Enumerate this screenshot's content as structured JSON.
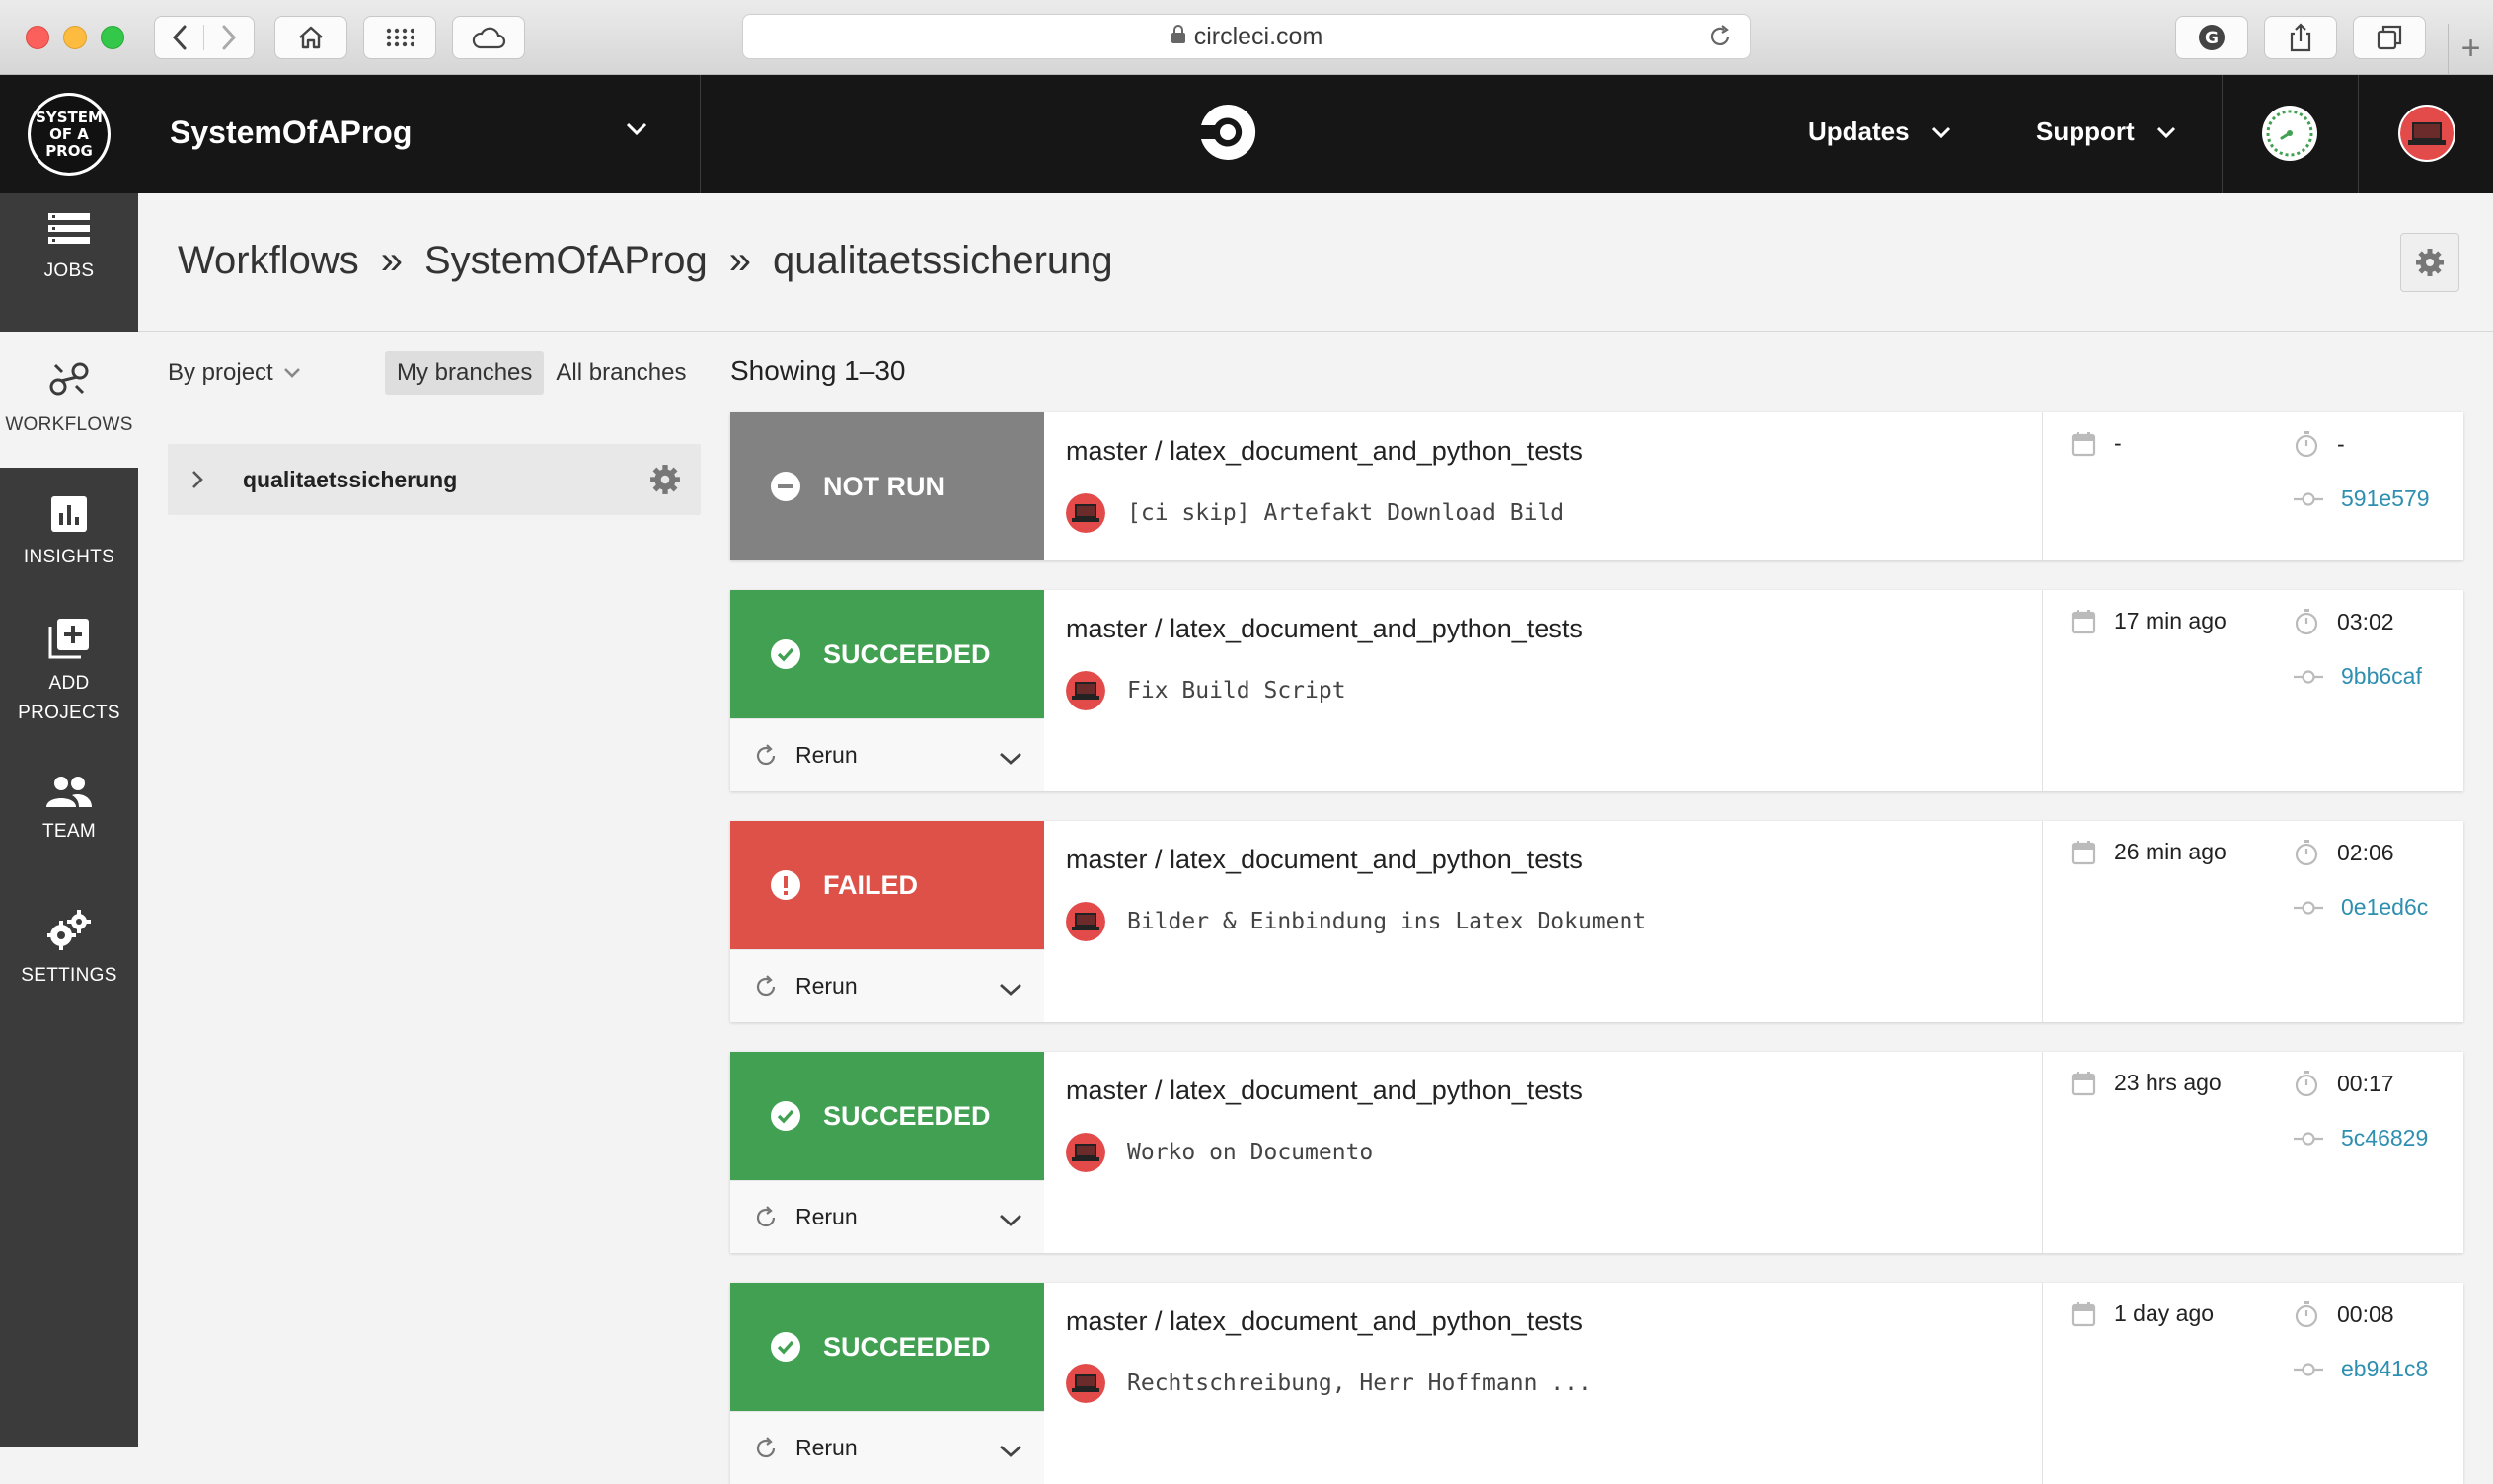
{
  "browser": {
    "url": "circleci.com",
    "new_tab_symbol": "+"
  },
  "header": {
    "org_logo_text": "SYSTEM OF A PROG",
    "org_name": "SystemOfAProg",
    "updates_label": "Updates",
    "support_label": "Support"
  },
  "sidebar": {
    "items": [
      {
        "label": "JOBS",
        "icon": "jobs-icon"
      },
      {
        "label": "WORKFLOWS",
        "icon": "workflows-icon"
      },
      {
        "label": "INSIGHTS",
        "icon": "insights-icon"
      },
      {
        "label": "ADD",
        "label2": "PROJECTS",
        "icon": "add-projects-icon"
      },
      {
        "label": "TEAM",
        "icon": "team-icon"
      },
      {
        "label": "SETTINGS",
        "icon": "settings-icon"
      }
    ]
  },
  "breadcrumb": {
    "items": [
      "Workflows",
      "SystemOfAProg",
      "qualitaetssicherung"
    ],
    "separator": "»"
  },
  "filters": {
    "by_project_label": "By project",
    "my_branches_label": "My branches",
    "all_branches_label": "All branches",
    "selected_branch_filter": "My branches",
    "project_name": "qualitaetssicherung"
  },
  "list": {
    "showing_label": "Showing 1–30",
    "rerun_label": "Rerun",
    "workflows": [
      {
        "status": "NOT RUN",
        "title": "master / latex_document_and_python_tests",
        "commit": "[ci skip] Artefakt Download Bild",
        "date": "-",
        "duration": "-",
        "hash": "591e579"
      },
      {
        "status": "SUCCEEDED",
        "title": "master / latex_document_and_python_tests",
        "commit": "Fix Build Script",
        "date": "17 min ago",
        "duration": "03:02",
        "hash": "9bb6caf"
      },
      {
        "status": "FAILED",
        "title": "master / latex_document_and_python_tests",
        "commit": "Bilder & Einbindung ins Latex Dokument",
        "date": "26 min ago",
        "duration": "02:06",
        "hash": "0e1ed6c"
      },
      {
        "status": "SUCCEEDED",
        "title": "master / latex_document_and_python_tests",
        "commit": "Worko on Documento",
        "date": "23 hrs ago",
        "duration": "00:17",
        "hash": "5c46829"
      },
      {
        "status": "SUCCEEDED",
        "title": "master / latex_document_and_python_tests",
        "commit": "Rechtschreibung, Herr Hoffmann ...",
        "date": "1 day ago",
        "duration": "00:08",
        "hash": "eb941c8"
      }
    ]
  },
  "colors": {
    "not_run": "#828282",
    "succeeded": "#42a052",
    "failed": "#dd5149",
    "hash_link": "#2e8fb0",
    "header_bg": "#161616",
    "sidebar_bg": "#3b3b3b"
  }
}
